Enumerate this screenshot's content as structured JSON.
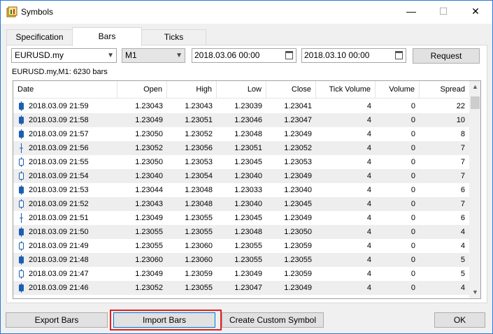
{
  "window": {
    "title": "Symbols",
    "minimize": "—",
    "maximize": "☐",
    "close": "✕"
  },
  "tabs": [
    {
      "label": "Specification"
    },
    {
      "label": "Bars"
    },
    {
      "label": "Ticks"
    }
  ],
  "toolbar": {
    "symbol": "EURUSD.my",
    "timeframe": "M1",
    "from": "2018.03.06 00:00",
    "to": "2018.03.10 00:00",
    "request_label": "Request"
  },
  "info": "EURUSD.my,M1: 6230 bars",
  "columns": [
    "Date",
    "Open",
    "High",
    "Low",
    "Close",
    "Tick Volume",
    "Volume",
    "Spread"
  ],
  "rows": [
    {
      "dir": "bull",
      "date": "2018.03.09 21:59",
      "open": "1.23043",
      "high": "1.23043",
      "low": "1.23039",
      "close": "1.23041",
      "tickvol": "4",
      "vol": "0",
      "spread": "22"
    },
    {
      "dir": "bull",
      "date": "2018.03.09 21:58",
      "open": "1.23049",
      "high": "1.23051",
      "low": "1.23046",
      "close": "1.23047",
      "tickvol": "4",
      "vol": "0",
      "spread": "10"
    },
    {
      "dir": "bull",
      "date": "2018.03.09 21:57",
      "open": "1.23050",
      "high": "1.23052",
      "low": "1.23048",
      "close": "1.23049",
      "tickvol": "4",
      "vol": "0",
      "spread": "8"
    },
    {
      "dir": "doji",
      "date": "2018.03.09 21:56",
      "open": "1.23052",
      "high": "1.23056",
      "low": "1.23051",
      "close": "1.23052",
      "tickvol": "4",
      "vol": "0",
      "spread": "7"
    },
    {
      "dir": "bear",
      "date": "2018.03.09 21:55",
      "open": "1.23050",
      "high": "1.23053",
      "low": "1.23045",
      "close": "1.23053",
      "tickvol": "4",
      "vol": "0",
      "spread": "7"
    },
    {
      "dir": "bear",
      "date": "2018.03.09 21:54",
      "open": "1.23040",
      "high": "1.23054",
      "low": "1.23040",
      "close": "1.23049",
      "tickvol": "4",
      "vol": "0",
      "spread": "7"
    },
    {
      "dir": "bull",
      "date": "2018.03.09 21:53",
      "open": "1.23044",
      "high": "1.23048",
      "low": "1.23033",
      "close": "1.23040",
      "tickvol": "4",
      "vol": "0",
      "spread": "6"
    },
    {
      "dir": "bear",
      "date": "2018.03.09 21:52",
      "open": "1.23043",
      "high": "1.23048",
      "low": "1.23040",
      "close": "1.23045",
      "tickvol": "4",
      "vol": "0",
      "spread": "7"
    },
    {
      "dir": "doji",
      "date": "2018.03.09 21:51",
      "open": "1.23049",
      "high": "1.23055",
      "low": "1.23045",
      "close": "1.23049",
      "tickvol": "4",
      "vol": "0",
      "spread": "6"
    },
    {
      "dir": "bull",
      "date": "2018.03.09 21:50",
      "open": "1.23055",
      "high": "1.23055",
      "low": "1.23048",
      "close": "1.23050",
      "tickvol": "4",
      "vol": "0",
      "spread": "4"
    },
    {
      "dir": "bear",
      "date": "2018.03.09 21:49",
      "open": "1.23055",
      "high": "1.23060",
      "low": "1.23055",
      "close": "1.23059",
      "tickvol": "4",
      "vol": "0",
      "spread": "4"
    },
    {
      "dir": "bull",
      "date": "2018.03.09 21:48",
      "open": "1.23060",
      "high": "1.23060",
      "low": "1.23055",
      "close": "1.23055",
      "tickvol": "4",
      "vol": "0",
      "spread": "5"
    },
    {
      "dir": "bear",
      "date": "2018.03.09 21:47",
      "open": "1.23049",
      "high": "1.23059",
      "low": "1.23049",
      "close": "1.23059",
      "tickvol": "4",
      "vol": "0",
      "spread": "5"
    },
    {
      "dir": "bull",
      "date": "2018.03.09 21:46",
      "open": "1.23052",
      "high": "1.23055",
      "low": "1.23047",
      "close": "1.23049",
      "tickvol": "4",
      "vol": "0",
      "spread": "4"
    }
  ],
  "buttons": {
    "export": "Export Bars",
    "import": "Import Bars",
    "custom": "Create Custom Symbol",
    "ok": "OK"
  },
  "colors": {
    "bull_candle": "#1c5fb0",
    "highlight": "#e0201e",
    "accent": "#0078d7"
  },
  "icons": {
    "scroll_up": "▲",
    "scroll_down": "▼",
    "dropdown": "▼"
  }
}
